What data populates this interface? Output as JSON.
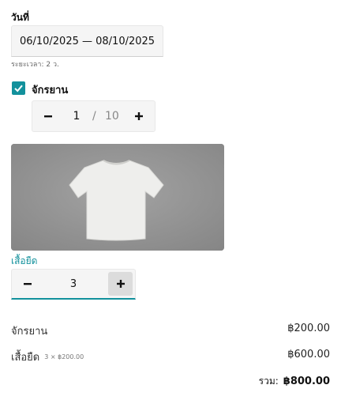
{
  "date_range": {
    "label": "วันที่",
    "value": "06/10/2025 — 08/10/2025",
    "duration": "ระยะเวลา: 2 ว."
  },
  "bicycle": {
    "checkbox_label": "จักรยาน",
    "checked": true,
    "quantity": "1",
    "separator": "/",
    "max": "10",
    "minus_icon": "minus-icon",
    "plus_icon": "plus-icon"
  },
  "tshirt": {
    "label": "เสื้อยืด",
    "quantity": "3",
    "image": "white-tshirt-photo"
  },
  "summary": {
    "lines": [
      {
        "name": "จักรยาน",
        "detail": "",
        "price": "฿200.00"
      },
      {
        "name": "เสื้อยืด",
        "detail": "3 × ฿200.00",
        "price": "฿600.00"
      }
    ],
    "total_label": "รวม:",
    "total_value": "฿800.00"
  },
  "colors": {
    "accent": "#12919c",
    "image_background": "#8f8f8f"
  }
}
